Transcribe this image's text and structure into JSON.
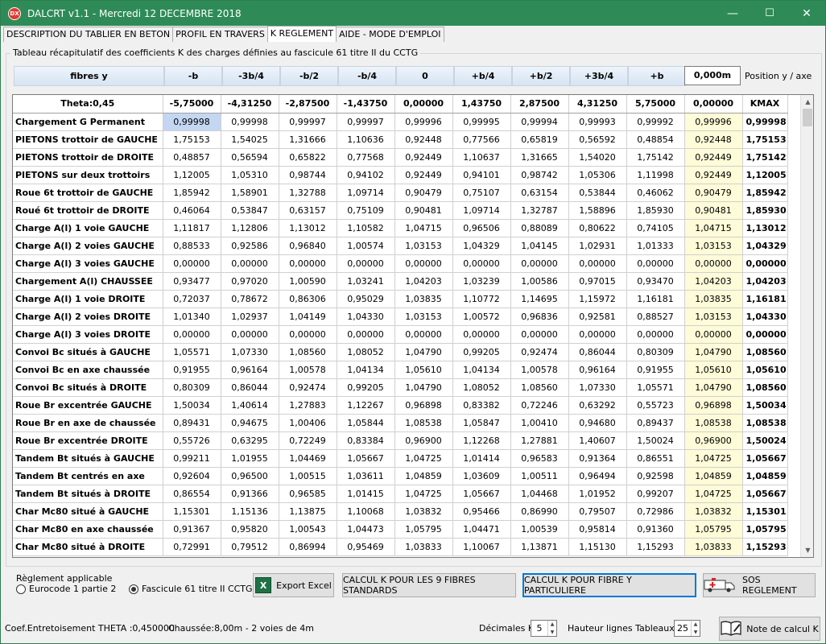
{
  "window": {
    "title": "DALCRT v1.1 - Mercredi 12 DECEMBRE 2018",
    "app_icon_text": "DX",
    "minimize": "—",
    "maximize": "☐",
    "close": "✕"
  },
  "tabs": [
    {
      "label": "DESCRIPTION DU TABLIER EN BETON",
      "active": false
    },
    {
      "label": "PROFIL EN TRAVERS",
      "active": false
    },
    {
      "label": "K REGLEMENT",
      "active": true
    },
    {
      "label": "AIDE - MODE D'EMPLOI",
      "active": false
    }
  ],
  "group_title": "Tableau récapitulatif des coefficients K des charges définies au fascicule 61 titre II du CCTG",
  "fibres": {
    "header_label": "fibres y",
    "positions": [
      "-b",
      "-3b/4",
      "-b/2",
      "-b/4",
      "0",
      "+b/4",
      "+b/2",
      "+3b/4",
      "+b"
    ],
    "position_value": "0,000m",
    "position_label": "Position y / axe"
  },
  "table": {
    "headers": [
      "Theta:0,45",
      "-5,75000",
      "-4,31250",
      "-2,87500",
      "-1,43750",
      "0,00000",
      "1,43750",
      "2,87500",
      "4,31250",
      "5,75000",
      "0,00000",
      "KMAX"
    ],
    "rows": [
      [
        "Chargement G  Permanent",
        "0,99998",
        "0,99998",
        "0,99997",
        "0,99997",
        "0,99996",
        "0,99995",
        "0,99994",
        "0,99993",
        "0,99992",
        "0,99996",
        "0,99998"
      ],
      [
        "PIETONS trottoir de GAUCHE",
        "1,75153",
        "1,54025",
        "1,31666",
        "1,10636",
        "0,92448",
        "0,77566",
        "0,65819",
        "0,56592",
        "0,48854",
        "0,92448",
        "1,75153"
      ],
      [
        "PIETONS trottoir de DROITE",
        "0,48857",
        "0,56594",
        "0,65822",
        "0,77568",
        "0,92449",
        "1,10637",
        "1,31665",
        "1,54020",
        "1,75142",
        "0,92449",
        "1,75142"
      ],
      [
        "PIETONS sur deux trottoirs",
        "1,12005",
        "1,05310",
        "0,98744",
        "0,94102",
        "0,92449",
        "0,94101",
        "0,98742",
        "1,05306",
        "1,11998",
        "0,92449",
        "1,12005"
      ],
      [
        "Roue 6t trottoir de GAUCHE",
        "1,85942",
        "1,58901",
        "1,32788",
        "1,09714",
        "0,90479",
        "0,75107",
        "0,63154",
        "0,53844",
        "0,46062",
        "0,90479",
        "1,85942"
      ],
      [
        "Roué 6t trottoir de DROITE",
        "0,46064",
        "0,53847",
        "0,63157",
        "0,75109",
        "0,90481",
        "1,09714",
        "1,32787",
        "1,58896",
        "1,85930",
        "0,90481",
        "1,85930"
      ],
      [
        "Charge A(l) 1 voie GAUCHE",
        "1,11817",
        "1,12806",
        "1,13012",
        "1,10582",
        "1,04715",
        "0,96506",
        "0,88089",
        "0,80622",
        "0,74105",
        "1,04715",
        "1,13012"
      ],
      [
        "Charge A(l) 2 voies GAUCHE",
        "0,88533",
        "0,92586",
        "0,96840",
        "1,00574",
        "1,03153",
        "1,04329",
        "1,04145",
        "1,02931",
        "1,01333",
        "1,03153",
        "1,04329"
      ],
      [
        "Charge A(l) 3 voies GAUCHE",
        "0,00000",
        "0,00000",
        "0,00000",
        "0,00000",
        "0,00000",
        "0,00000",
        "0,00000",
        "0,00000",
        "0,00000",
        "0,00000",
        "0,00000"
      ],
      [
        "Chargement A(l) CHAUSSEE",
        "0,93477",
        "0,97020",
        "1,00590",
        "1,03241",
        "1,04203",
        "1,03239",
        "1,00586",
        "0,97015",
        "0,93470",
        "1,04203",
        "1,04203"
      ],
      [
        "Charge A(l) 1 voie DROITE",
        "0,72037",
        "0,78672",
        "0,86306",
        "0,95029",
        "1,03835",
        "1,10772",
        "1,14695",
        "1,15972",
        "1,16181",
        "1,03835",
        "1,16181"
      ],
      [
        "Charge A(l) 2 voies DROITE",
        "1,01340",
        "1,02937",
        "1,04149",
        "1,04330",
        "1,03153",
        "1,00572",
        "0,96836",
        "0,92581",
        "0,88527",
        "1,03153",
        "1,04330"
      ],
      [
        "Charge A(l) 3 voies DROITE",
        "0,00000",
        "0,00000",
        "0,00000",
        "0,00000",
        "0,00000",
        "0,00000",
        "0,00000",
        "0,00000",
        "0,00000",
        "0,00000",
        "0,00000"
      ],
      [
        "Convoi Bc situés à GAUCHE",
        "1,05571",
        "1,07330",
        "1,08560",
        "1,08052",
        "1,04790",
        "0,99205",
        "0,92474",
        "0,86044",
        "0,80309",
        "1,04790",
        "1,08560"
      ],
      [
        "Convoi Bc en axe chaussée",
        "0,91955",
        "0,96164",
        "1,00578",
        "1,04134",
        "1,05610",
        "1,04134",
        "1,00578",
        "0,96164",
        "0,91955",
        "1,05610",
        "1,05610"
      ],
      [
        "Convoi Bc situés à DROITE",
        "0,80309",
        "0,86044",
        "0,92474",
        "0,99205",
        "1,04790",
        "1,08052",
        "1,08560",
        "1,07330",
        "1,05571",
        "1,04790",
        "1,08560"
      ],
      [
        "Roue Br excentrée GAUCHE",
        "1,50034",
        "1,40614",
        "1,27883",
        "1,12267",
        "0,96898",
        "0,83382",
        "0,72246",
        "0,63292",
        "0,55723",
        "0,96898",
        "1,50034"
      ],
      [
        "Roue Br en axe de chaussée",
        "0,89431",
        "0,94675",
        "1,00406",
        "1,05844",
        "1,08538",
        "1,05847",
        "1,00410",
        "0,94680",
        "0,89437",
        "1,08538",
        "1,08538"
      ],
      [
        "Roue Br excentrée DROITE",
        "0,55726",
        "0,63295",
        "0,72249",
        "0,83384",
        "0,96900",
        "1,12268",
        "1,27881",
        "1,40607",
        "1,50024",
        "0,96900",
        "1,50024"
      ],
      [
        "Tandem Bt situés à GAUCHE",
        "0,99211",
        "1,01955",
        "1,04469",
        "1,05667",
        "1,04725",
        "1,01414",
        "0,96583",
        "0,91364",
        "0,86551",
        "1,04725",
        "1,05667"
      ],
      [
        "Tandem Bt centrés en axe",
        "0,92604",
        "0,96500",
        "1,00515",
        "1,03611",
        "1,04859",
        "1,03609",
        "1,00511",
        "0,96494",
        "0,92598",
        "1,04859",
        "1,04859"
      ],
      [
        "Tandem Bt situés à DROITE",
        "0,86554",
        "0,91366",
        "0,96585",
        "1,01415",
        "1,04725",
        "1,05667",
        "1,04468",
        "1,01952",
        "0,99207",
        "1,04725",
        "1,05667"
      ],
      [
        "Char Mc80 situé à GAUCHE",
        "1,15301",
        "1,15136",
        "1,13875",
        "1,10068",
        "1,03832",
        "0,95466",
        "0,86990",
        "0,79507",
        "0,72986",
        "1,03832",
        "1,15301"
      ],
      [
        "Char Mc80 en axe chaussée",
        "0,91367",
        "0,95820",
        "1,00543",
        "1,04473",
        "1,05795",
        "1,04471",
        "1,00539",
        "0,95814",
        "0,91360",
        "1,05795",
        "1,05795"
      ],
      [
        "Char Mc80 situé à DROITE",
        "0,72991",
        "0,79512",
        "0,86994",
        "0,95469",
        "1,03833",
        "1,10067",
        "1,13871",
        "1,15130",
        "1,15293",
        "1,03833",
        "1,15293"
      ]
    ]
  },
  "reglement": {
    "title": "Règlement applicable",
    "options": [
      {
        "label": "Eurocode 1 partie 2",
        "checked": false
      },
      {
        "label": "Fascicule 61 titre II CCTG",
        "checked": true
      }
    ]
  },
  "buttons": {
    "export_excel": "Export Excel",
    "excel_icon": "X",
    "calcul_9": "CALCUL K POUR LES 9 FIBRES STANDARDS",
    "calcul_particuliere": "CALCUL K POUR FIBRE Y PARTICULIERE",
    "sos": "SOS REGLEMENT",
    "note": "Note de calcul K"
  },
  "status": {
    "coef": "Coef.Entretoisement THETA :0,450000",
    "chaussee": "Chaussée:8,00m - 2 voies de 4m",
    "decimales_label": "Décimales K",
    "decimales_value": "5",
    "hauteur_label": "Hauteur lignes Tableaux K",
    "hauteur_value": "25"
  },
  "colors": {
    "titlebar": "#2e8b57",
    "selected_cell": "#c4d7f2",
    "position_column": "#fdfbd8"
  }
}
